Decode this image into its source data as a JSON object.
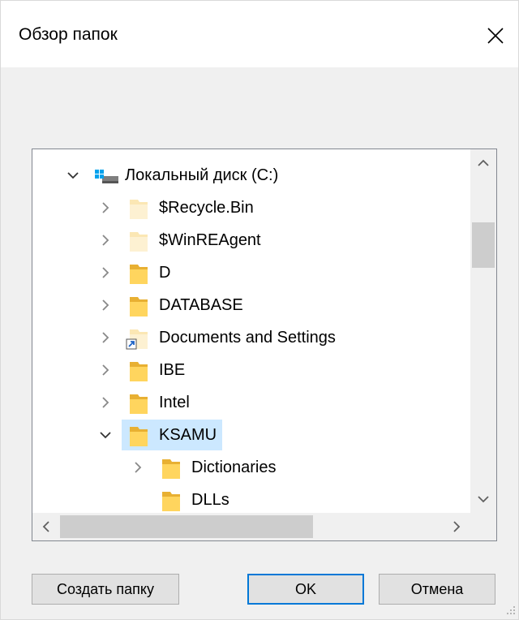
{
  "dialog": {
    "title": "Обзор папок"
  },
  "tree": {
    "items": [
      {
        "label": "Локальный диск (C:)",
        "level": 0,
        "expanded": true,
        "icon": "drive-icon"
      },
      {
        "label": "$Recycle.Bin",
        "level": 1,
        "expanded": false,
        "icon": "folder-hidden-icon"
      },
      {
        "label": "$WinREAgent",
        "level": 1,
        "expanded": false,
        "icon": "folder-hidden-icon"
      },
      {
        "label": "D",
        "level": 1,
        "expanded": false,
        "icon": "folder-icon"
      },
      {
        "label": "DATABASE",
        "level": 1,
        "expanded": false,
        "icon": "folder-icon"
      },
      {
        "label": "Documents and Settings",
        "level": 1,
        "expanded": false,
        "icon": "folder-shortcut-icon"
      },
      {
        "label": "IBE",
        "level": 1,
        "expanded": false,
        "icon": "folder-icon"
      },
      {
        "label": "Intel",
        "level": 1,
        "expanded": false,
        "icon": "folder-icon"
      },
      {
        "label": "KSAMU",
        "level": 1,
        "expanded": true,
        "selected": true,
        "icon": "folder-icon"
      },
      {
        "label": "Dictionaries",
        "level": 2,
        "expanded": false,
        "icon": "folder-icon"
      },
      {
        "label": "DLLs",
        "level": 2,
        "icon": "folder-icon"
      }
    ]
  },
  "buttons": {
    "new_folder": "Создать папку",
    "ok": "OK",
    "cancel": "Отмена"
  },
  "colors": {
    "selection": "#cce8ff",
    "default_button_border": "#0078d7",
    "folder_fill": "#ffd55e",
    "hidden_folder_fill": "#fbe7b4"
  }
}
